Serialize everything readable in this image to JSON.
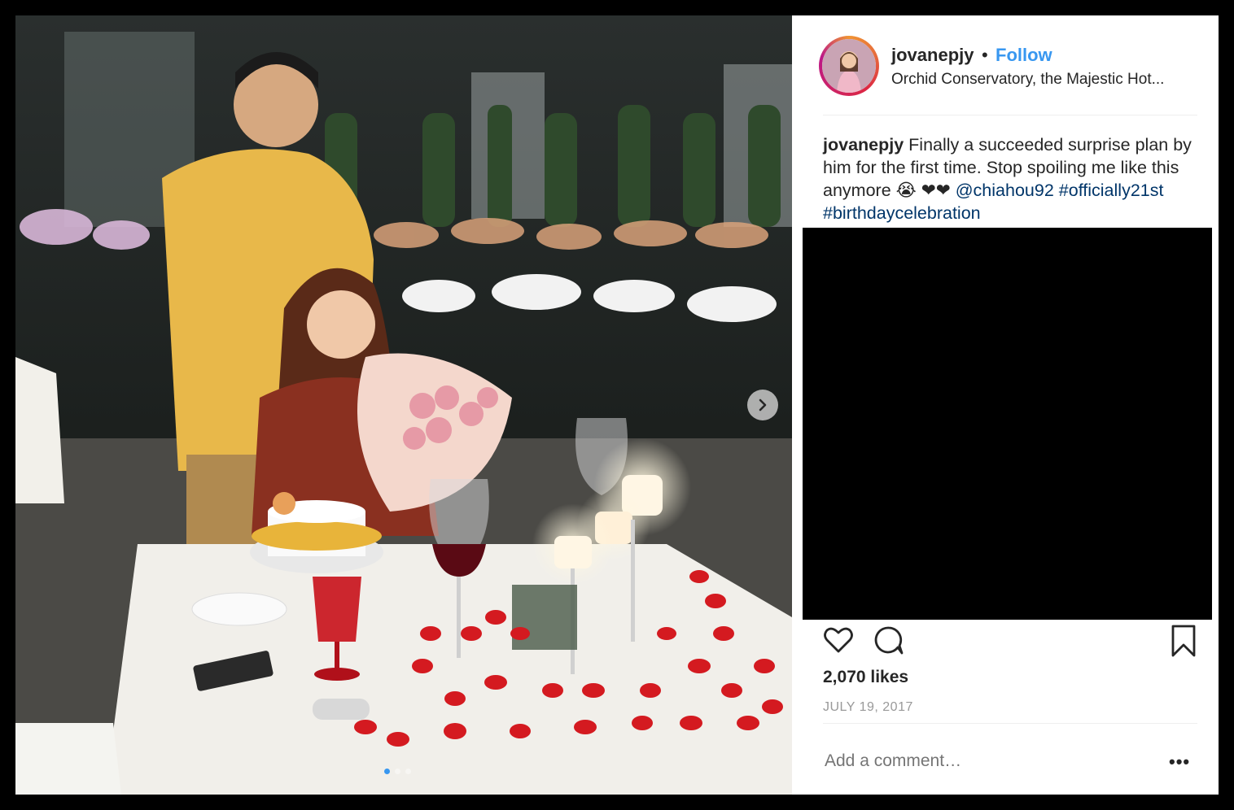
{
  "post": {
    "username": "jovanepjy",
    "separator": "•",
    "follow_label": "Follow",
    "location": "Orchid Conservatory, the Majestic Hot...",
    "caption": {
      "user": "jovanepjy",
      "text": " Finally a succeeded surprise plan by him for the first time. Stop spoiling me like this anymore 😭 ❤❤ ",
      "mention": "@chiahou92",
      "hashtag1": "#officially21st",
      "hashtag2": "#birthdaycelebration"
    },
    "likes": "2,070 likes",
    "date": "JULY 19, 2017",
    "comment_placeholder": "Add a comment…",
    "more_label": "•••"
  },
  "carousel": {
    "total": 3,
    "current": 1
  },
  "colors": {
    "link": "#003569",
    "follow": "#3897f0",
    "text": "#262626",
    "muted": "#999999"
  },
  "icons": {
    "next": "chevron-right-icon",
    "like": "heart-icon",
    "comment": "comment-icon",
    "save": "bookmark-icon"
  }
}
